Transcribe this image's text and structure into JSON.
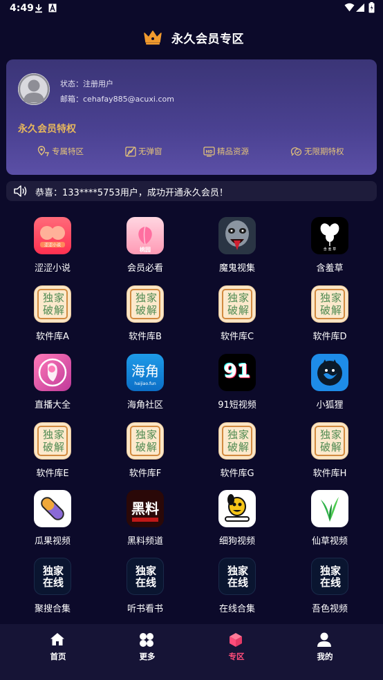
{
  "status_bar": {
    "time": "4:49"
  },
  "header": {
    "title": "永久会员专区",
    "icon": "crown-icon"
  },
  "member_card": {
    "status_label": "状态：注册用户",
    "email_label": "邮箱：cehafay885@acuxi.com",
    "privilege_title": "永久会员特权",
    "perks": [
      {
        "label": "专属特区",
        "icon": "location-icon"
      },
      {
        "label": "无弹窗",
        "icon": "no-popup-icon"
      },
      {
        "label": "精品资源",
        "icon": "hd-icon"
      },
      {
        "label": "无限期特权",
        "icon": "infinite-icon"
      }
    ],
    "accent_color": "#e7b85d"
  },
  "notice": {
    "text": "恭喜：133****5753用户，成功开通永久会员！"
  },
  "apps": [
    {
      "label": "涩涩小说",
      "icon": "novel-icon"
    },
    {
      "label": "会员必看",
      "icon": "peach-icon"
    },
    {
      "label": "魔鬼视集",
      "icon": "demon-icon"
    },
    {
      "label": "含羞草",
      "icon": "mimosa-icon"
    },
    {
      "label": "软件库A",
      "icon": "crack-icon",
      "icon_text_1": "独家",
      "icon_text_2": "破解"
    },
    {
      "label": "软件库B",
      "icon": "crack-icon",
      "icon_text_1": "独家",
      "icon_text_2": "破解"
    },
    {
      "label": "软件库C",
      "icon": "crack-icon",
      "icon_text_1": "独家",
      "icon_text_2": "破解"
    },
    {
      "label": "软件库D",
      "icon": "crack-icon",
      "icon_text_1": "独家",
      "icon_text_2": "破解"
    },
    {
      "label": "直播大全",
      "icon": "live-icon"
    },
    {
      "label": "海角社区",
      "icon": "haijiao-icon",
      "icon_text_1": "海角",
      "icon_text_2": "haijiao.fun"
    },
    {
      "label": "91短视频",
      "icon": "video-91-icon",
      "icon_text_1": "91"
    },
    {
      "label": "小狐狸",
      "icon": "fox-icon"
    },
    {
      "label": "软件库E",
      "icon": "crack-icon",
      "icon_text_1": "独家",
      "icon_text_2": "破解"
    },
    {
      "label": "软件库F",
      "icon": "crack-icon",
      "icon_text_1": "独家",
      "icon_text_2": "破解"
    },
    {
      "label": "软件库G",
      "icon": "crack-icon",
      "icon_text_1": "独家",
      "icon_text_2": "破解"
    },
    {
      "label": "软件库H",
      "icon": "crack-icon",
      "icon_text_1": "独家",
      "icon_text_2": "破解"
    },
    {
      "label": "瓜果视频",
      "icon": "pill-icon"
    },
    {
      "label": "黑料频道",
      "icon": "heiliao-icon",
      "icon_text_1": "黑料"
    },
    {
      "label": "细狗视频",
      "icon": "dog-icon"
    },
    {
      "label": "仙草视频",
      "icon": "grass-icon"
    },
    {
      "label": "聚搜合集",
      "icon": "online-icon",
      "icon_text_1": "独家",
      "icon_text_2": "在线"
    },
    {
      "label": "听书看书",
      "icon": "online-icon",
      "icon_text_1": "独家",
      "icon_text_2": "在线"
    },
    {
      "label": "在线合集",
      "icon": "online-icon",
      "icon_text_1": "独家",
      "icon_text_2": "在线"
    },
    {
      "label": "吾色视频",
      "icon": "online-icon",
      "icon_text_1": "独家",
      "icon_text_2": "在线"
    }
  ],
  "bottom_nav": {
    "items": [
      {
        "label": "首页",
        "icon": "home-icon"
      },
      {
        "label": "更多",
        "icon": "grid-icon"
      },
      {
        "label": "专区",
        "icon": "cube-icon",
        "active": true
      },
      {
        "label": "我的",
        "icon": "user-icon"
      }
    ],
    "active_color": "#ff4d7a"
  }
}
